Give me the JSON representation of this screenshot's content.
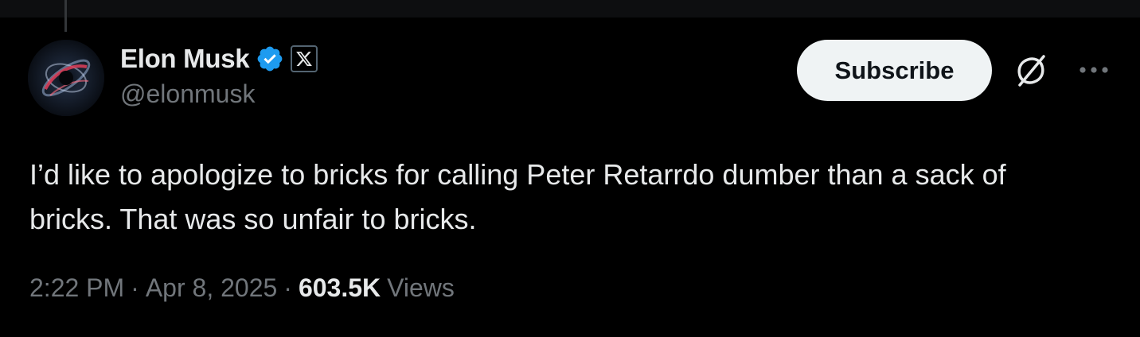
{
  "author": {
    "display_name": "Elon Musk",
    "handle": "@elonmusk",
    "verified_badge_icon": "verified-check-icon",
    "affiliate_badge_icon": "x-logo-icon",
    "avatar_icon": "galaxy-avatar"
  },
  "actions": {
    "subscribe_label": "Subscribe",
    "grok_icon": "grok-icon",
    "more_icon": "more-dots-icon"
  },
  "tweet": {
    "text": "I’d like to apologize to bricks for calling Peter Retarrdo dumber than a sack of bricks. That was so unfair to bricks."
  },
  "meta": {
    "time": "2:22 PM",
    "separator": "·",
    "date": "Apr 8, 2025",
    "views_count": "603.5K",
    "views_label": "Views"
  },
  "colors": {
    "background": "#000000",
    "primary_text": "#e7e9ea",
    "secondary_text": "#71767b",
    "verified_blue": "#1d9bf0",
    "button_bg": "#eff3f4"
  }
}
